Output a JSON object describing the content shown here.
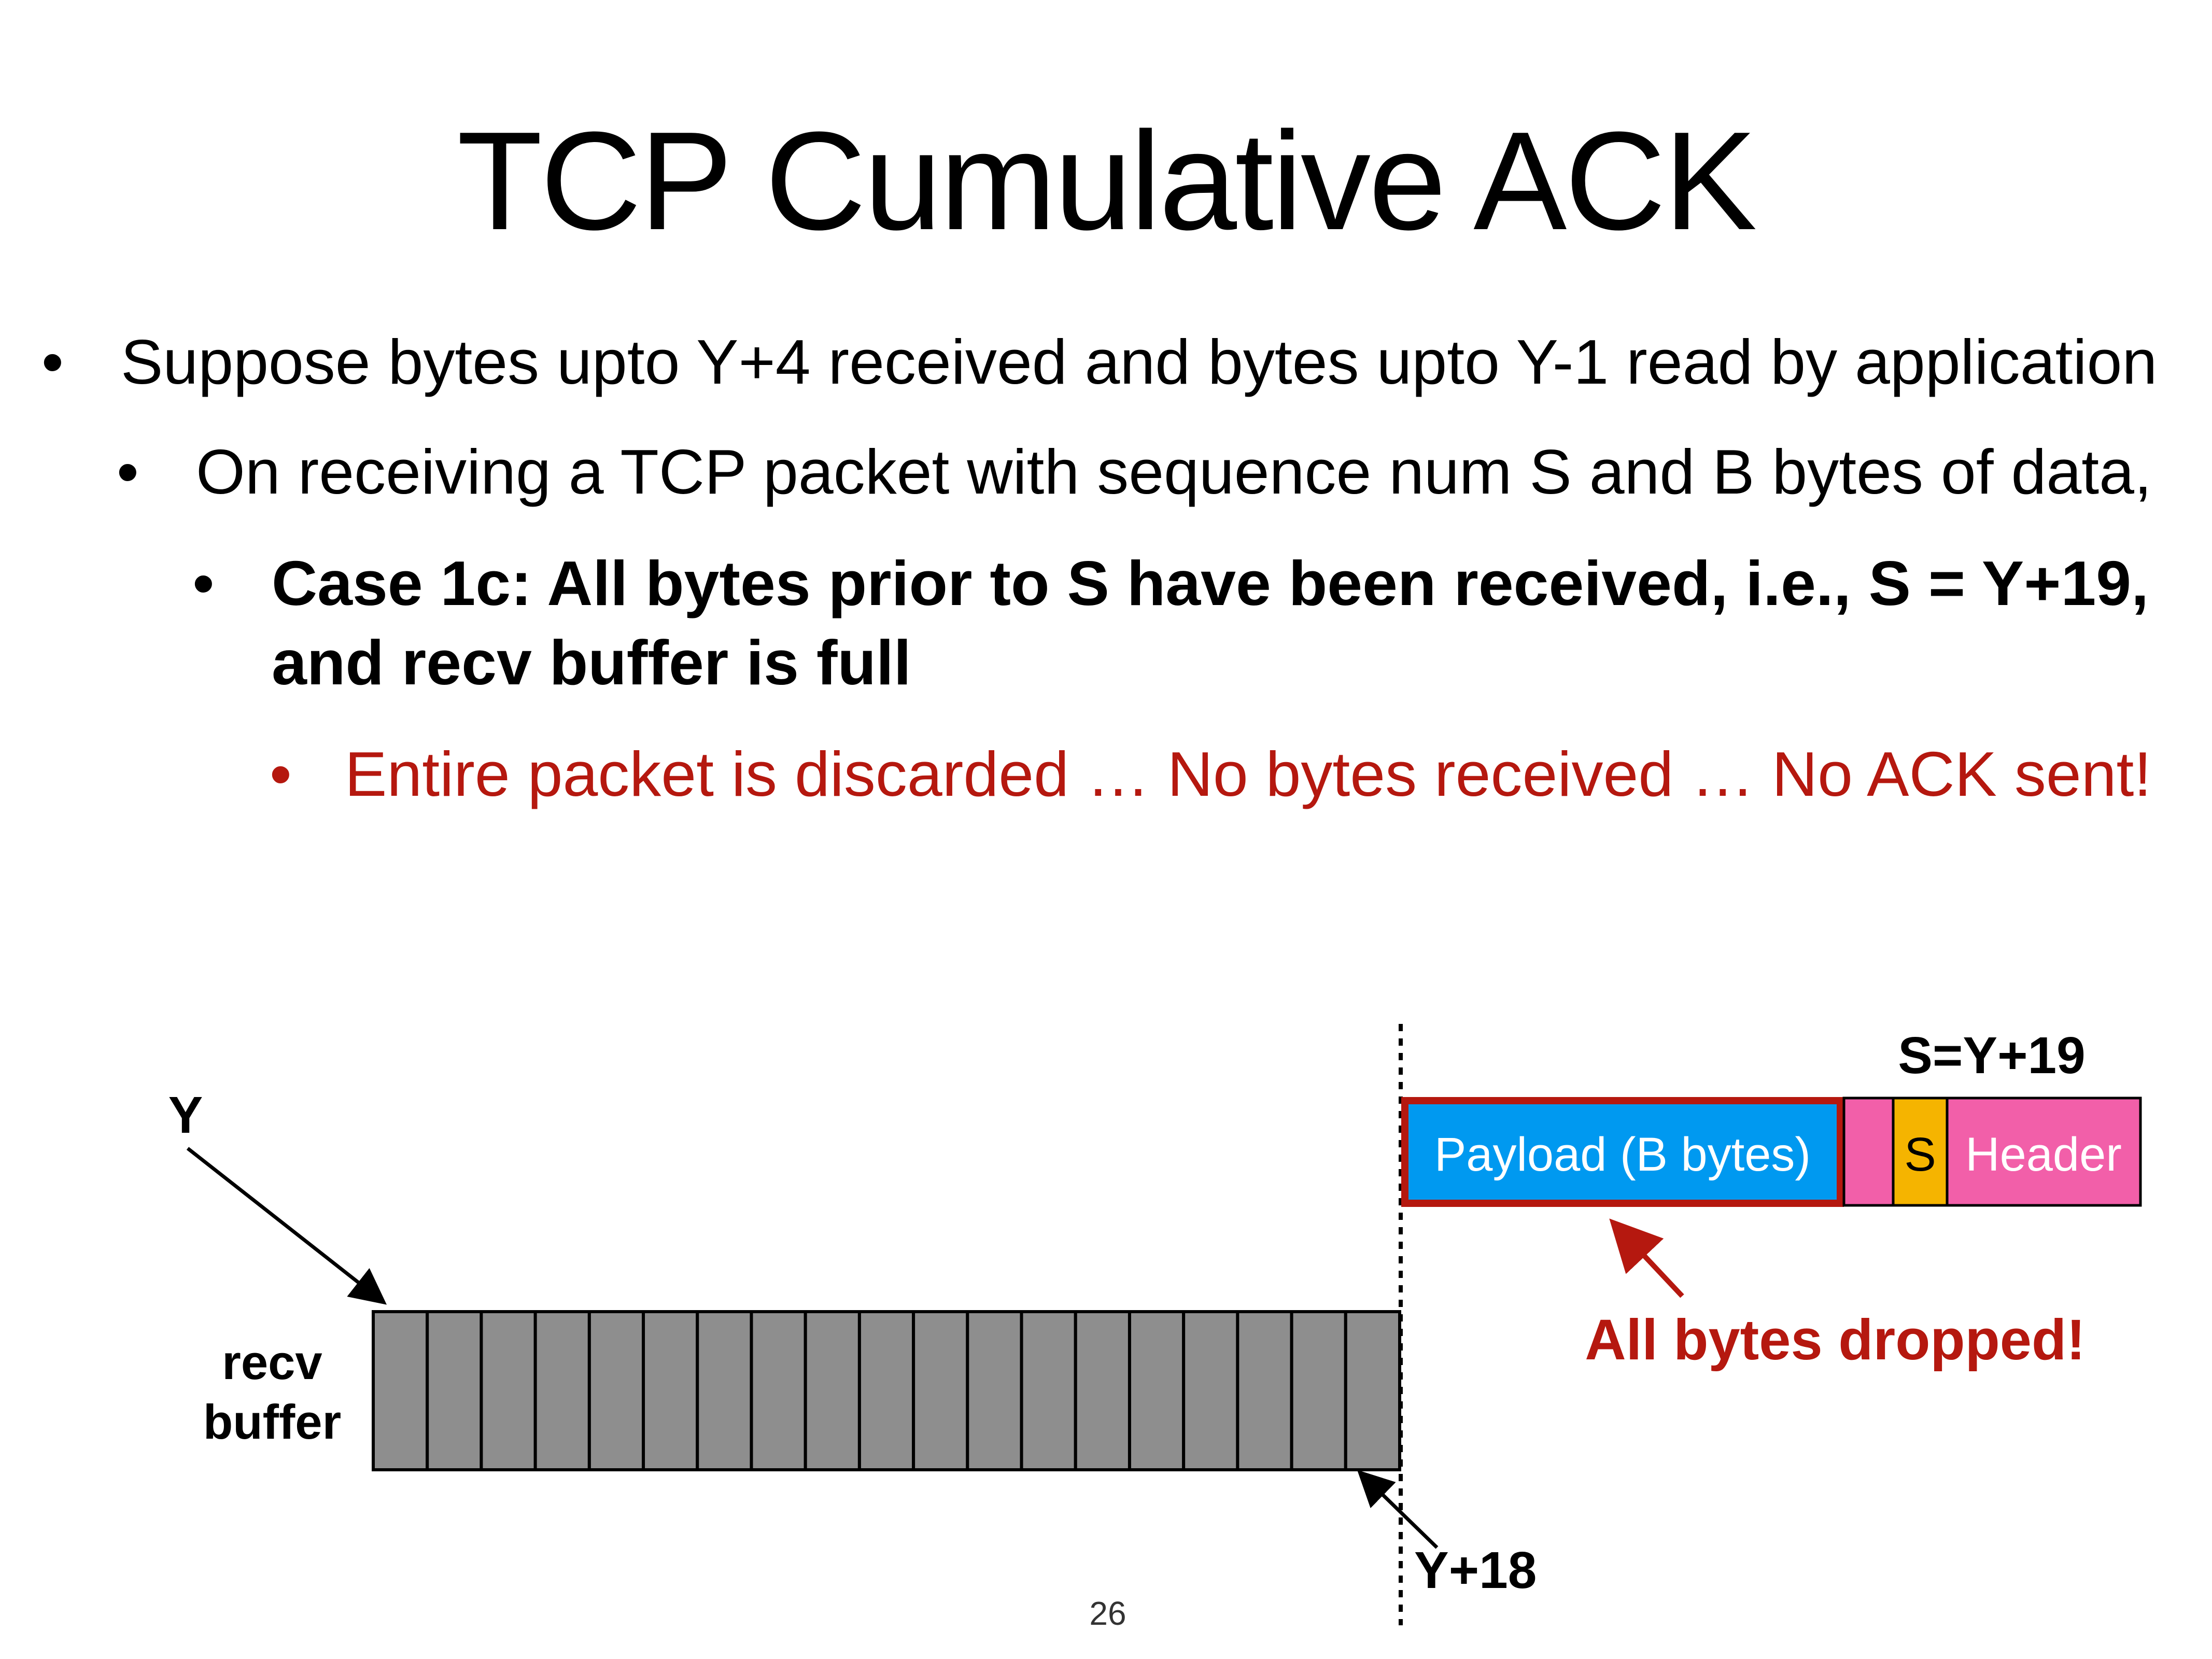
{
  "slide": {
    "title": "TCP Cumulative ACK",
    "bullets": [
      "Suppose bytes upto Y+4 received and bytes upto Y-1 read by application",
      "On receiving a TCP packet with sequence num S and B bytes of data,",
      "Case 1c: All bytes prior to S have been received, i.e., S = Y+19,",
      "and recv buffer is full",
      "Entire packet is discarded … No bytes received … No ACK sent!"
    ],
    "bullet_glyph": "•",
    "page_number": "26"
  },
  "diagram": {
    "y_label": "Y",
    "recv_label_1": "recv",
    "recv_label_2": "buffer",
    "y18_label": "Y+18",
    "s_label": "S=Y+19",
    "payload_label": "Payload (B bytes)",
    "s_cell": "S",
    "header_label": "Header",
    "dropped_label": "All bytes dropped!",
    "buffer_cell_count": 19,
    "colors": {
      "buffer_fill": "#8e8e8e",
      "payload_fill": "#0099f0",
      "payload_border": "#b5180f",
      "header_fill": "#f25fa9",
      "s_fill": "#f5b400",
      "accent_red": "#b5180f"
    }
  }
}
